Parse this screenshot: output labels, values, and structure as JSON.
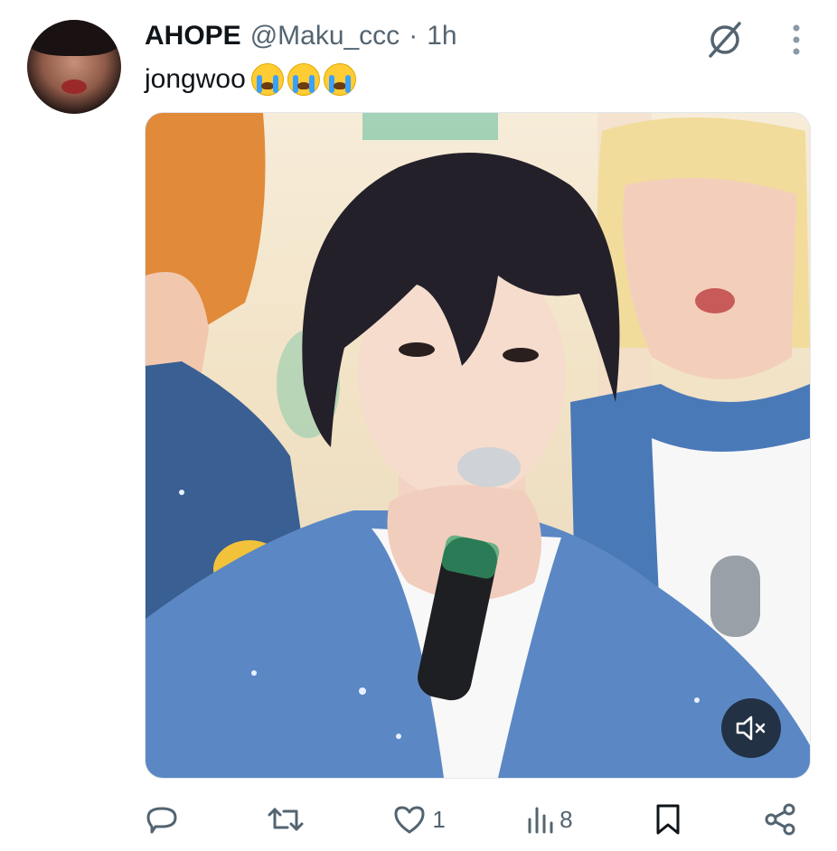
{
  "author": {
    "name": "AHOPE",
    "handle": "@Maku_ccc",
    "separator": "·",
    "time": "1h"
  },
  "tweet": {
    "text": "jongwoo",
    "emojis": [
      "loudly-crying-face",
      "loudly-crying-face",
      "loudly-crying-face"
    ]
  },
  "header_icons": [
    "grok-icon",
    "more-vertical-icon"
  ],
  "media": {
    "type": "video",
    "mute_icon": "volume-muted-icon"
  },
  "actions": {
    "reply_count": "",
    "retweet_count": "",
    "like_count": "1",
    "views_count": "8"
  },
  "colors": {
    "text_primary": "#0f1419",
    "text_secondary": "#536471",
    "border": "#e1e8ed"
  }
}
